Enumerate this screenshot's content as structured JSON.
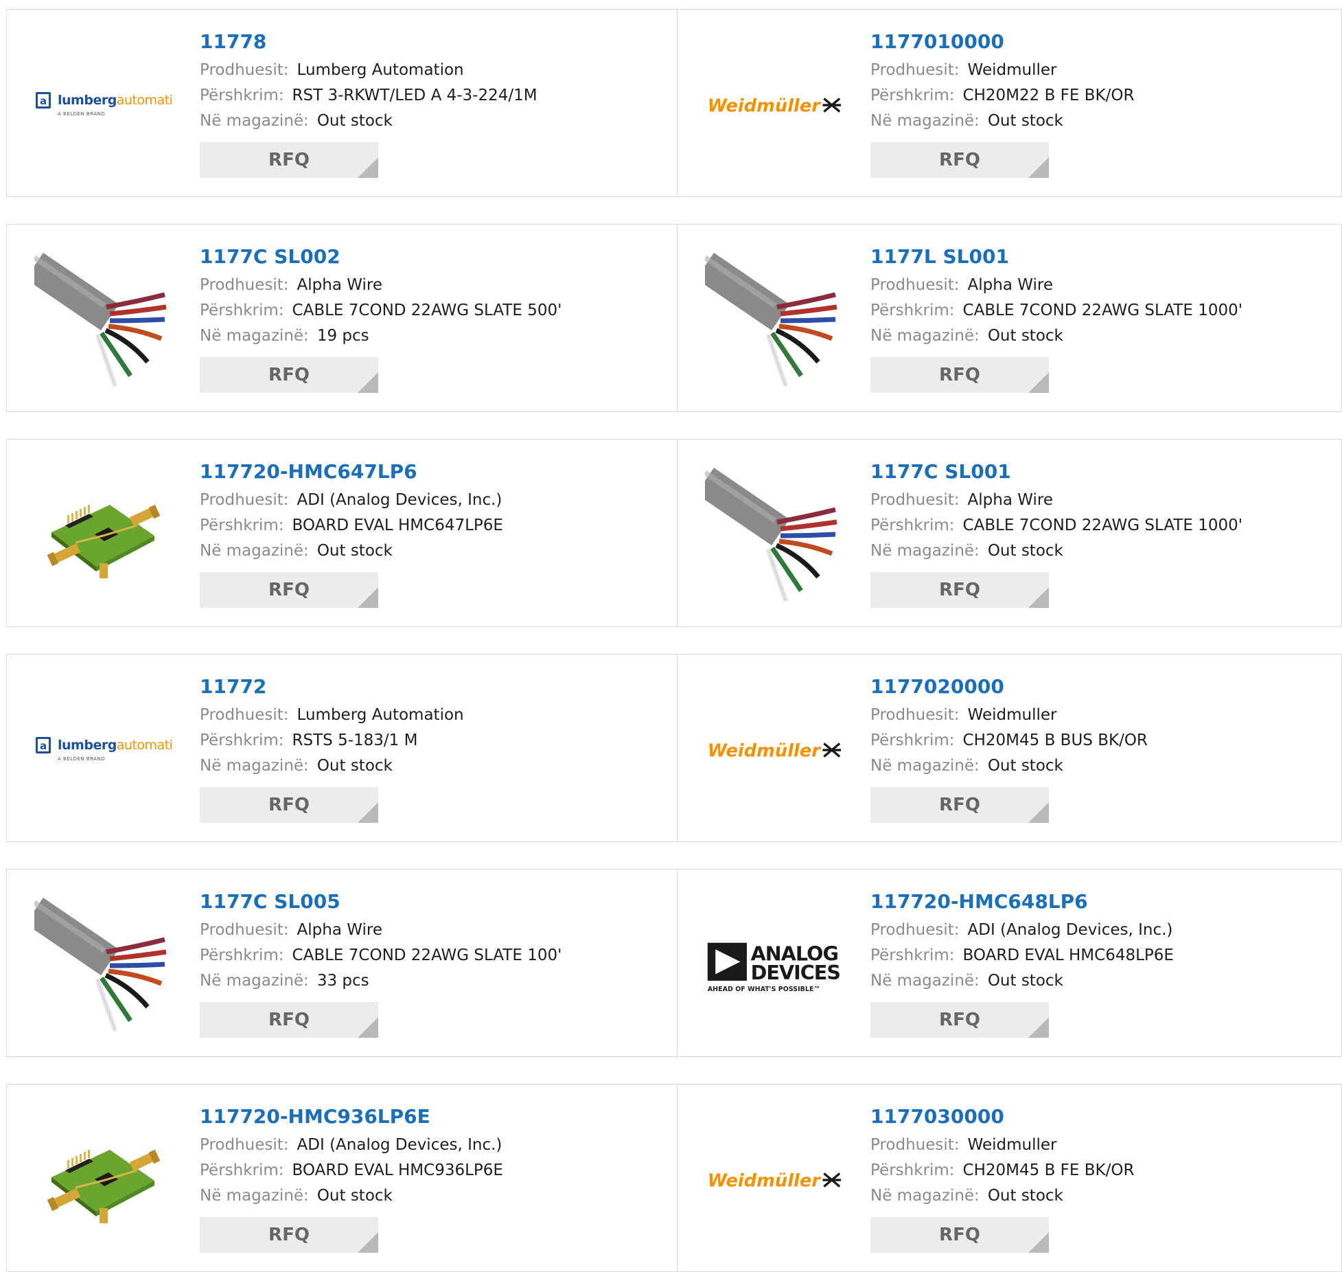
{
  "labels": {
    "manufacturer": "Prodhuesit:",
    "description": "Përshkrim:",
    "stock": "Në magazinë:",
    "rfq": "RFQ"
  },
  "brands": {
    "lumberg": {
      "main": "lumberg",
      "accent": "automation",
      "sub": "A BELDEN BRAND",
      "badge": "a"
    },
    "weidmuller": {
      "name": "Weidmüller"
    },
    "analog": {
      "line1": "ANALOG",
      "line2": "DEVICES",
      "tagline": "AHEAD OF WHAT'S POSSIBLE™"
    }
  },
  "products": [
    {
      "part": "11778",
      "manufacturer": "Lumberg Automation",
      "description": "RST 3-RKWT/LED A 4-3-224/1M",
      "stock": "Out stock",
      "image": "lumberg-logo"
    },
    {
      "part": "1177010000",
      "manufacturer": "Weidmuller",
      "description": "CH20M22 B FE BK/OR",
      "stock": "Out stock",
      "image": "weidmuller-logo"
    },
    {
      "part": "1177C SL002",
      "manufacturer": "Alpha Wire",
      "description": "CABLE 7COND 22AWG SLATE 500'",
      "stock": "19 pcs",
      "image": "cable-photo"
    },
    {
      "part": "1177L SL001",
      "manufacturer": "Alpha Wire",
      "description": "CABLE 7COND 22AWG SLATE 1000'",
      "stock": "Out stock",
      "image": "cable-photo"
    },
    {
      "part": "117720-HMC647LP6",
      "manufacturer": "ADI (Analog Devices, Inc.)",
      "description": "BOARD EVAL HMC647LP6E",
      "stock": "Out stock",
      "image": "eval-board-photo"
    },
    {
      "part": "1177C SL001",
      "manufacturer": "Alpha Wire",
      "description": "CABLE 7COND 22AWG SLATE 1000'",
      "stock": "Out stock",
      "image": "cable-photo"
    },
    {
      "part": "11772",
      "manufacturer": "Lumberg Automation",
      "description": "RSTS 5-183/1 M",
      "stock": "Out stock",
      "image": "lumberg-logo"
    },
    {
      "part": "1177020000",
      "manufacturer": "Weidmuller",
      "description": "CH20M45 B BUS BK/OR",
      "stock": "Out stock",
      "image": "weidmuller-logo"
    },
    {
      "part": "1177C SL005",
      "manufacturer": "Alpha Wire",
      "description": "CABLE 7COND 22AWG SLATE 100'",
      "stock": "33 pcs",
      "image": "cable-photo"
    },
    {
      "part": "117720-HMC648LP6",
      "manufacturer": "ADI (Analog Devices, Inc.)",
      "description": "BOARD EVAL HMC648LP6E",
      "stock": "Out stock",
      "image": "analog-devices-logo"
    },
    {
      "part": "117720-HMC936LP6E",
      "manufacturer": "ADI (Analog Devices, Inc.)",
      "description": "BOARD EVAL HMC936LP6E",
      "stock": "Out stock",
      "image": "eval-board-photo"
    },
    {
      "part": "1177030000",
      "manufacturer": "Weidmuller",
      "description": "CH20M45 B FE BK/OR",
      "stock": "Out stock",
      "image": "weidmuller-logo"
    }
  ],
  "colors": {
    "part_link": "#1b6eb8",
    "label": "#8a8a8a",
    "border": "#d7d7d7",
    "rfq_bg": "#ececec",
    "weidmuller_orange": "#f39200",
    "lumberg_blue": "#1c4f9c"
  }
}
